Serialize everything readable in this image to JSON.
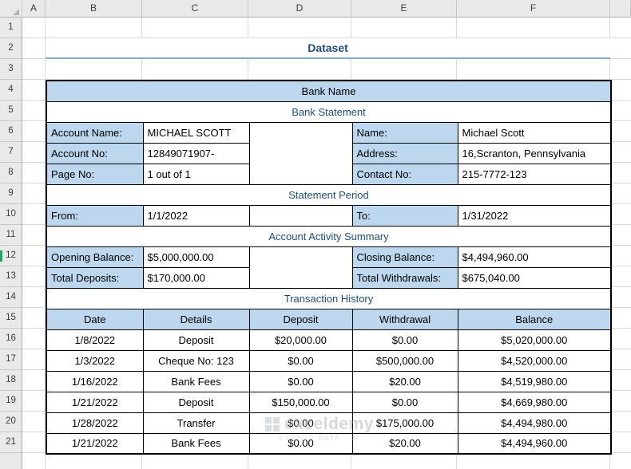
{
  "sheet": {
    "column_headers": [
      "A",
      "B",
      "C",
      "D",
      "E",
      "F"
    ],
    "row_headers": [
      "1",
      "2",
      "3",
      "4",
      "5",
      "6",
      "7",
      "8",
      "9",
      "10",
      "11",
      "12",
      "13",
      "14",
      "15",
      "16",
      "17",
      "18",
      "19",
      "20",
      "21"
    ]
  },
  "title": "Dataset",
  "statement": {
    "bank_name": "Bank Name",
    "section_bank_statement": "Bank Statement",
    "account_info": [
      {
        "label": "Account Name:",
        "value": "MICHAEL SCOTT"
      },
      {
        "label": "Account No:",
        "value": "12849071907-"
      },
      {
        "label": "Page No:",
        "value": "1 out of 1"
      }
    ],
    "holder_info": [
      {
        "label": "Name:",
        "value": "Michael Scott"
      },
      {
        "label": "Address:",
        "value": "16,Scranton, Pennsylvania"
      },
      {
        "label": "Contact No:",
        "value": "215-7772-123"
      }
    ],
    "section_statement_period": "Statement Period",
    "period": {
      "from_label": "From:",
      "from_value": "1/1/2022",
      "to_label": "To:",
      "to_value": "1/31/2022"
    },
    "section_summary": "Account Activity Summary",
    "summary_rows": [
      {
        "left_label": "Opening Balance:",
        "left_value": "$5,000,000.00",
        "right_label": "Closing Balance:",
        "right_value": "$4,494,960.00"
      },
      {
        "left_label": "Total Deposits:",
        "left_value": "$170,000.00",
        "right_label": "Total Withdrawals:",
        "right_value": "$675,040.00"
      }
    ],
    "section_history": "Transaction History",
    "history": {
      "headers": [
        "Date",
        "Details",
        "Deposit",
        "Withdrawal",
        "Balance"
      ],
      "rows": [
        [
          "1/8/2022",
          "Deposit",
          "$20,000.00",
          "$0.00",
          "$5,020,000.00"
        ],
        [
          "1/3/2022",
          "Cheque No: 123",
          "$0.00",
          "$500,000.00",
          "$4,520,000.00"
        ],
        [
          "1/16/2022",
          "Bank Fees",
          "$0.00",
          "$20.00",
          "$4,519,980.00"
        ],
        [
          "1/21/2022",
          "Deposit",
          "$150,000.00",
          "$0.00",
          "$4,669,980.00"
        ],
        [
          "1/28/2022",
          "Transfer",
          "$0.00",
          "$175,000.00",
          "$4,494,980.00"
        ],
        [
          "1/21/2022",
          "Bank Fees",
          "$0.00",
          "$20.00",
          "$4,494,960.00"
        ]
      ]
    }
  },
  "watermark": {
    "brand": "exceldemy",
    "tagline": "EXCEL · DATA · BI"
  },
  "colors": {
    "accent_blue": "#1F4E79",
    "fill_blue": "#BDD7EE",
    "underline_blue": "#7FABDB",
    "row_marker_green": "#21A366"
  }
}
